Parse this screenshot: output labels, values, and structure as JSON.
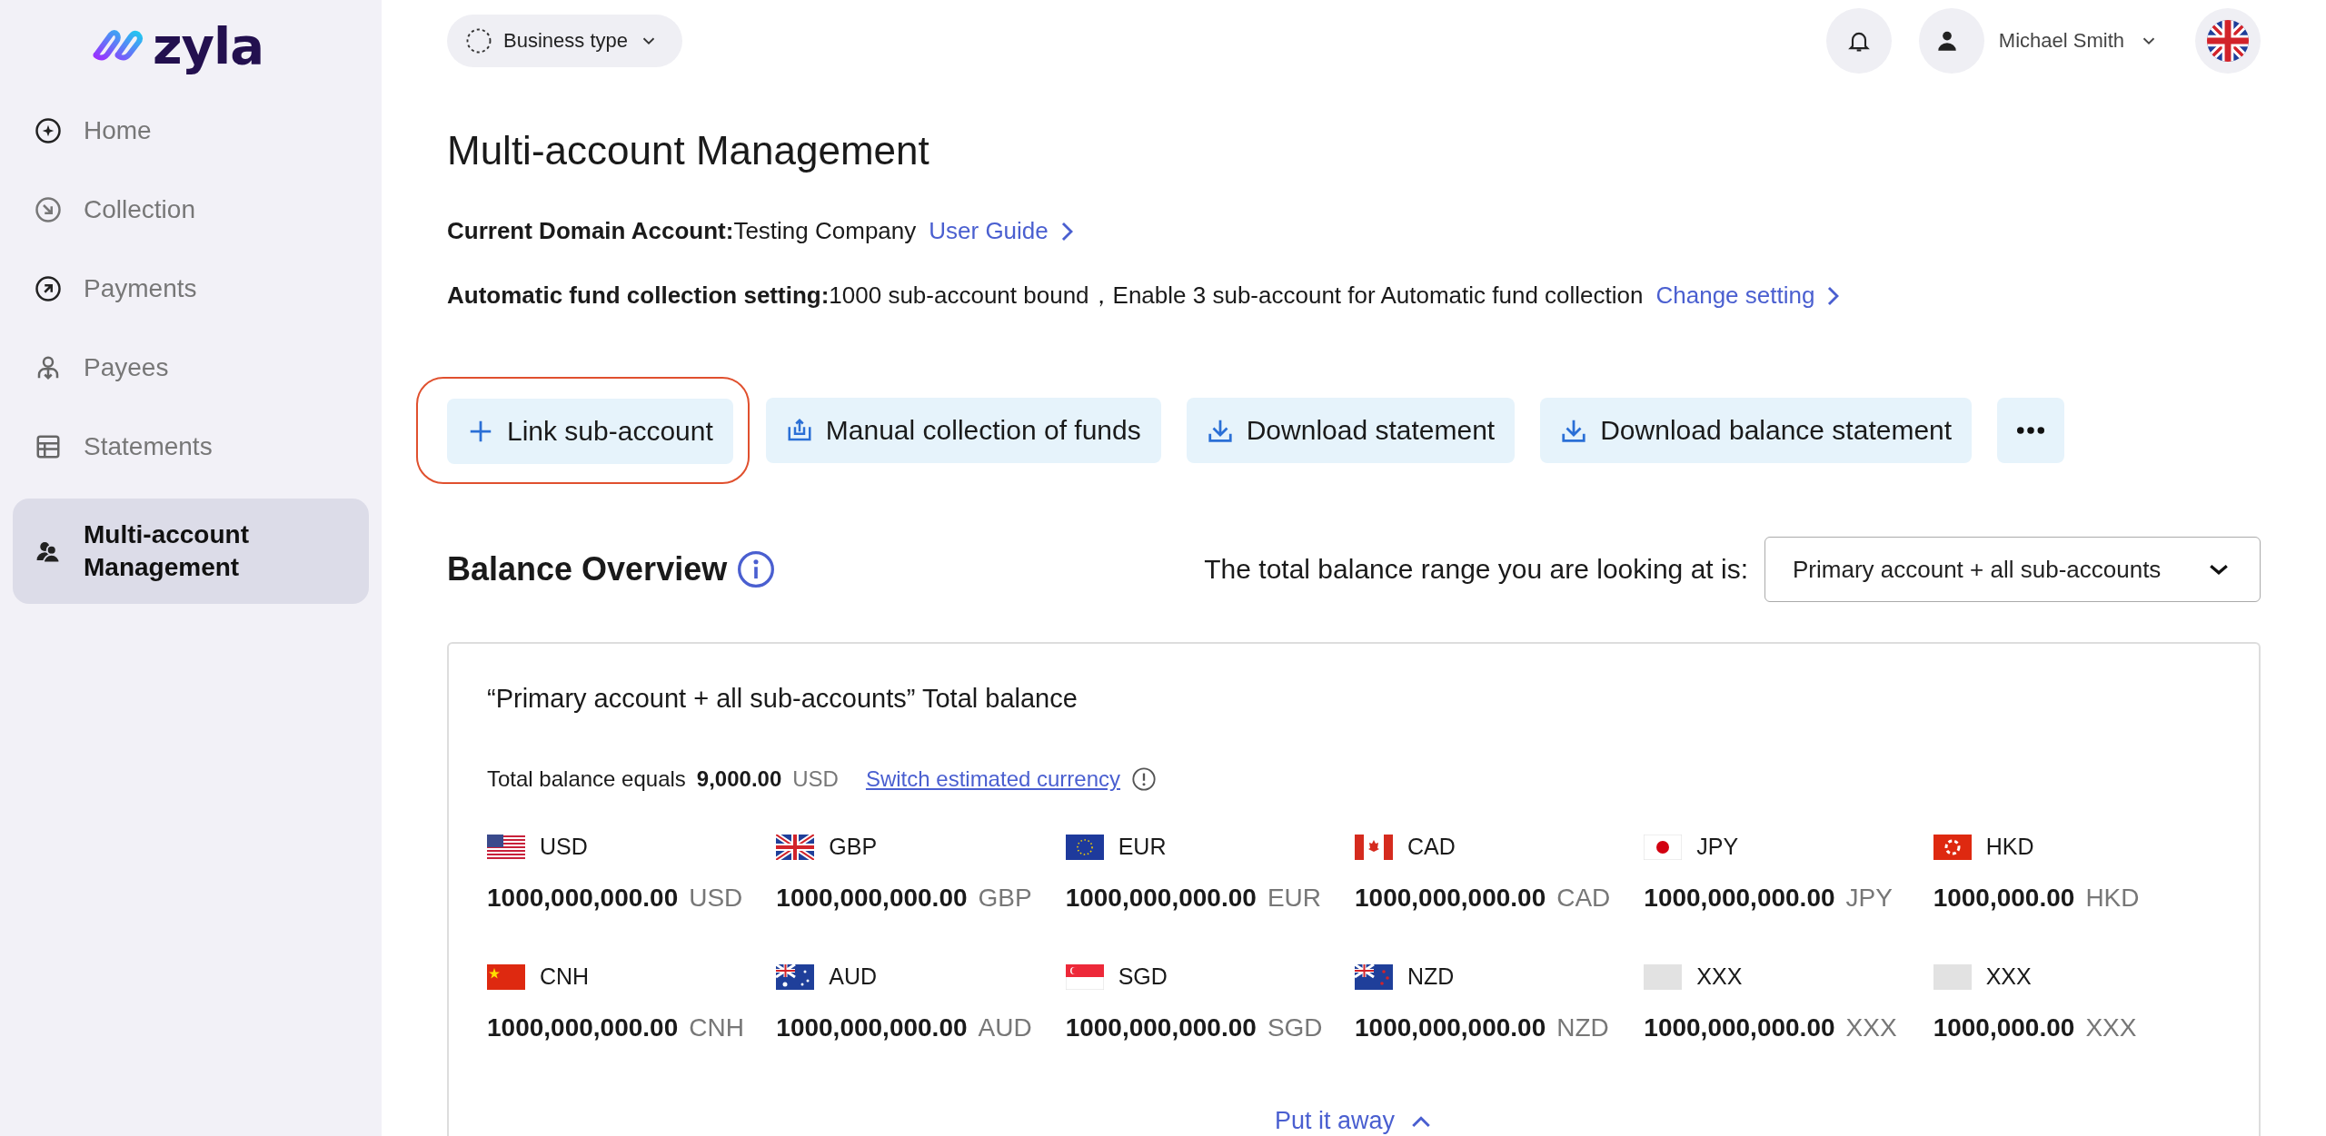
{
  "sidebar": {
    "logo": "zyla",
    "items": [
      {
        "label": "Home",
        "selected": false
      },
      {
        "label": "Collection",
        "selected": false
      },
      {
        "label": "Payments",
        "selected": false
      },
      {
        "label": "Payees",
        "selected": false
      },
      {
        "label": "Statements",
        "selected": false
      },
      {
        "label": "Multi-account Management",
        "selected": true
      }
    ]
  },
  "header": {
    "business_type": "Business type",
    "user": "Michael Smith"
  },
  "page": {
    "title": "Multi-account Management",
    "domain": "**Current Domain Account:**Testing Company",
    "user_guide": "User Guide",
    "auto": "**Automatic fund collection setting:**1000 sub-account bound，Enable 3 sub-account for Automatic fund collection",
    "change_setting": "Change setting"
  },
  "actions": [
    {
      "label": "Link sub-account",
      "kind": "plus",
      "highlighted": true
    },
    {
      "label": "Manual collection of funds",
      "kind": "upload",
      "highlighted": false
    },
    {
      "label": "Download statement",
      "kind": "download",
      "highlighted": false
    },
    {
      "label": "Download balance statement",
      "kind": "download",
      "highlighted": false
    },
    {
      "kind": "more",
      "highlighted": false
    }
  ],
  "balance": {
    "title": "Balance Overview",
    "range_label": "The total balance range you are looking at is:",
    "range_select": "Primary account + all sub-accounts",
    "card": {
      "title": "“Primary account + all sub-accounts” Total balance",
      "total_label": "Total balance equals",
      "total_amount": "9,000.00",
      "total_currency": "USD",
      "switch_link": "Switch estimated currency",
      "currencies": [
        {
          "code": "USD",
          "amount": "1000,000,000.00",
          "unit": "USD"
        },
        {
          "code": "GBP",
          "amount": "1000,000,000.00",
          "unit": "GBP"
        },
        {
          "code": "EUR",
          "amount": "1000,000,000.00",
          "unit": "EUR"
        },
        {
          "code": "CAD",
          "amount": "1000,000,000.00",
          "unit": "CAD"
        },
        {
          "code": "JPY",
          "amount": "1000,000,000.00",
          "unit": "JPY"
        },
        {
          "code": "HKD",
          "amount": "1000,000.00",
          "unit": "HKD"
        },
        {
          "code": "CNH",
          "amount": "1000,000,000.00",
          "unit": "CNH"
        },
        {
          "code": "AUD",
          "amount": "1000,000,000.00",
          "unit": "AUD"
        },
        {
          "code": "SGD",
          "amount": "1000,000,000.00",
          "unit": "SGD"
        },
        {
          "code": "NZD",
          "amount": "1000,000,000.00",
          "unit": "NZD"
        },
        {
          "code": "XXX",
          "amount": "1000,000,000.00",
          "unit": "XXX"
        },
        {
          "code": "XXX",
          "amount": "1000,000.00",
          "unit": "XXX"
        }
      ],
      "collapse": "Put it away"
    }
  }
}
